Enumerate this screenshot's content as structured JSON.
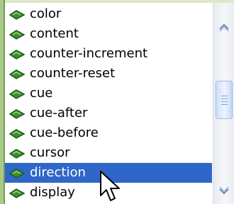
{
  "list": {
    "items": [
      {
        "label": "color"
      },
      {
        "label": "content"
      },
      {
        "label": "counter-increment"
      },
      {
        "label": "counter-reset"
      },
      {
        "label": "cue"
      },
      {
        "label": "cue-after"
      },
      {
        "label": "cue-before"
      },
      {
        "label": "cursor"
      },
      {
        "label": "direction"
      },
      {
        "label": "display"
      }
    ],
    "selected_label": "direction",
    "item_icon": "property-icon"
  },
  "colors": {
    "selection": "#2f67c9",
    "accent_green": "#6f9b52",
    "icon_green": "#2e7a22"
  },
  "scrollbar": {
    "up_icon": "chevron-up-icon",
    "down_icon": "chevron-down-icon"
  },
  "cursor": {
    "icon": "mouse-pointer-icon"
  }
}
